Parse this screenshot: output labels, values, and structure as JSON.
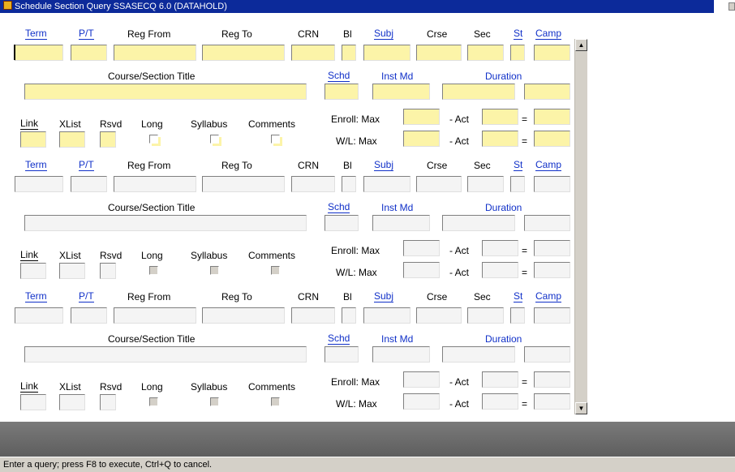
{
  "window": {
    "title": "Schedule Section Query  SSASECQ 6.0  (DATAHOLD)"
  },
  "labels": {
    "term": "Term",
    "pt": "P/T",
    "reg_from": "Reg From",
    "reg_to": "Reg To",
    "crn": "CRN",
    "bl": "Bl",
    "subj": "Subj",
    "crse": "Crse",
    "sec": "Sec",
    "st": "St",
    "camp": "Camp",
    "course_title": "Course/Section Title",
    "schd": "Schd",
    "inst_md": "Inst Md",
    "duration": "Duration",
    "link": "Link",
    "xlist": "XList",
    "rsvd": "Rsvd",
    "long": "Long",
    "syllabus": "Syllabus",
    "comments": "Comments",
    "enroll_max": "Enroll: Max",
    "wl_max": "W/L: Max",
    "act": "- Act",
    "equals": "="
  },
  "scrollbar": {
    "up_icon": "▲",
    "down_icon": "▼"
  },
  "colors": {
    "query_field": "#fcf4a8",
    "title_bar": "#0c2a9a",
    "block_label": "#1030c8"
  },
  "status": {
    "message": "Enter a query;  press F8 to execute, Ctrl+Q to cancel."
  }
}
